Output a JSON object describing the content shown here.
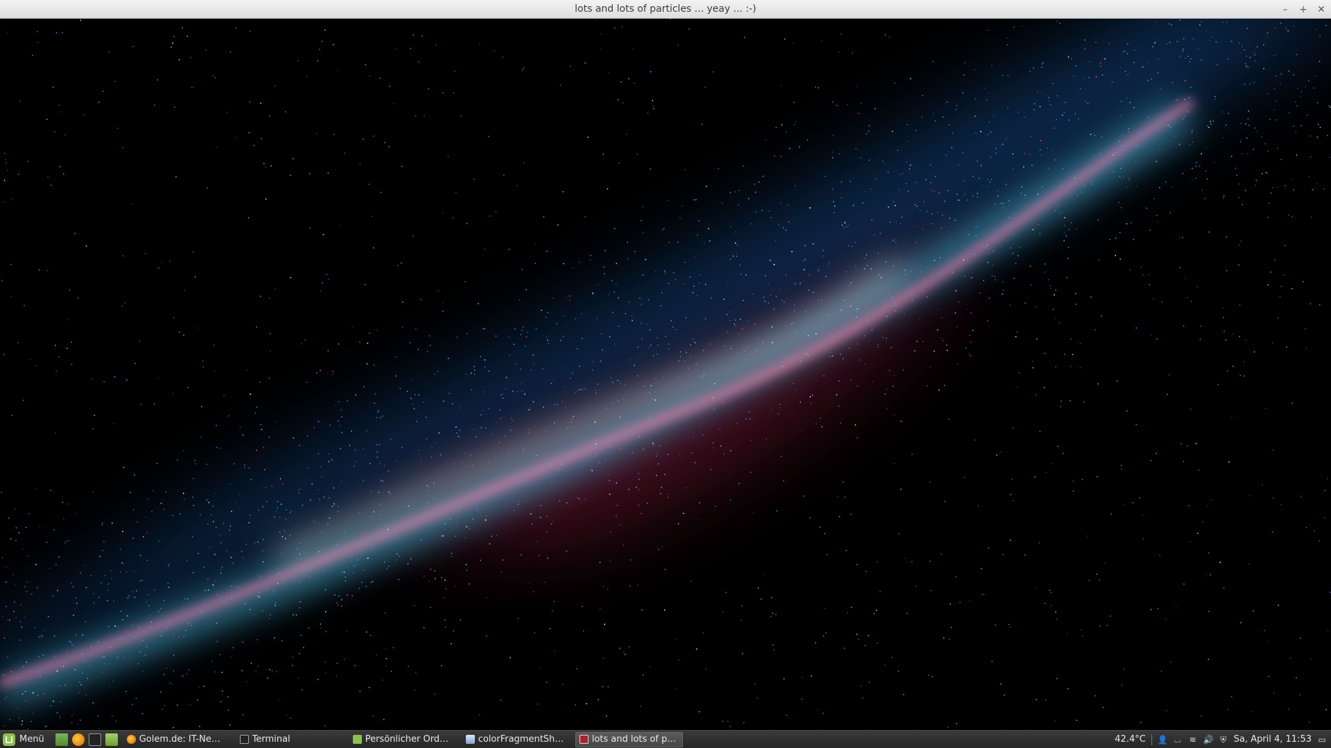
{
  "window": {
    "title": "lots and lots of particles ... yeay ... :-)",
    "controls": {
      "minimize": "–",
      "maximize": "+",
      "close": "✕"
    }
  },
  "taskbar": {
    "menu_label": "Menü",
    "launchers": [
      "desktop-icon",
      "firefox-icon",
      "terminal-icon",
      "folder-icon"
    ],
    "tasks": [
      {
        "label": "Golem.de: IT-News f...",
        "icon": "firefox-icon",
        "active": false
      },
      {
        "label": "Terminal",
        "icon": "terminal-icon",
        "active": false
      },
      {
        "label": "Persönlicher Ordner",
        "icon": "folder-icon",
        "active": false
      },
      {
        "label": "colorFragmentShade...",
        "icon": "editor-icon",
        "active": false
      },
      {
        "label": "lots and lots of particl...",
        "icon": "app-icon",
        "active": true
      }
    ],
    "temperature": "42.4°C",
    "clock": "Sa, April  4, 11:53"
  },
  "colors": {
    "particle_blue": "#3fa9ff",
    "particle_cyan": "#7fe8ff",
    "particle_red": "#ff3c6e",
    "particle_white": "#ffffff"
  }
}
